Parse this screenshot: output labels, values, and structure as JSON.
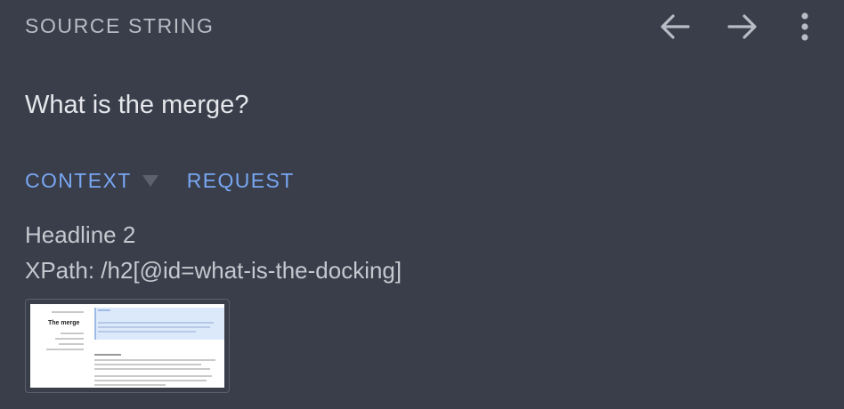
{
  "header": {
    "title": "SOURCE STRING"
  },
  "toolbar": {
    "back_icon": "arrow-left-icon",
    "forward_icon": "arrow-right-icon",
    "more_icon": "more-vertical-icon"
  },
  "source": {
    "text": "What is the merge?"
  },
  "tabs": [
    {
      "label": "CONTEXT",
      "has_dropdown": true
    },
    {
      "label": "REQUEST",
      "has_dropdown": false
    }
  ],
  "context": {
    "element_type": "Headline 2",
    "xpath": "XPath: /h2[@id=what-is-the-docking]"
  },
  "screenshot_thumbnail": {
    "page_title": "The merge"
  },
  "colors": {
    "background": "#393e4a",
    "accent": "#78a6f2",
    "header_text": "#b8bcc5",
    "icon": "#b8bcc5"
  }
}
